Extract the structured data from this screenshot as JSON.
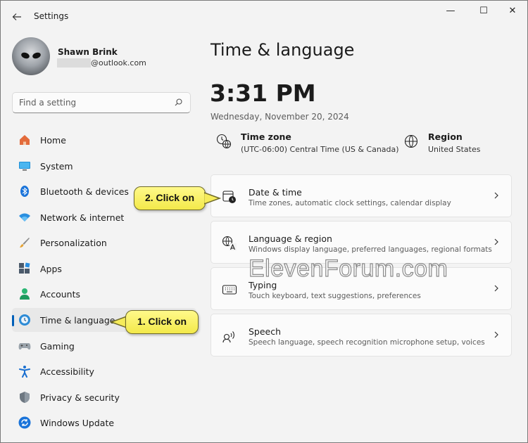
{
  "window": {
    "title": "Settings",
    "back_icon": "arrow-left-icon",
    "minimize_glyph": "—",
    "maximize_glyph": "☐",
    "close_glyph": "✕"
  },
  "user": {
    "name": "Shawn Brink",
    "email_suffix": "@outlook.com"
  },
  "search": {
    "placeholder": "Find a setting"
  },
  "sidebar": {
    "items": [
      {
        "label": "Home",
        "icon": "home-icon"
      },
      {
        "label": "System",
        "icon": "monitor-icon"
      },
      {
        "label": "Bluetooth & devices",
        "icon": "bluetooth-icon"
      },
      {
        "label": "Network & internet",
        "icon": "wifi-icon"
      },
      {
        "label": "Personalization",
        "icon": "brush-icon"
      },
      {
        "label": "Apps",
        "icon": "apps-icon"
      },
      {
        "label": "Accounts",
        "icon": "person-icon"
      },
      {
        "label": "Time & language",
        "icon": "globe-clock-icon",
        "selected": true
      },
      {
        "label": "Gaming",
        "icon": "gamepad-icon"
      },
      {
        "label": "Accessibility",
        "icon": "accessibility-icon"
      },
      {
        "label": "Privacy & security",
        "icon": "shield-icon"
      },
      {
        "label": "Windows Update",
        "icon": "update-icon"
      }
    ]
  },
  "main": {
    "title": "Time & language",
    "clock": "3:31 PM",
    "date": "Wednesday, November 20, 2024",
    "time_zone": {
      "label": "Time zone",
      "value": "(UTC-06:00) Central Time (US & Canada)"
    },
    "region": {
      "label": "Region",
      "value": "United States"
    },
    "cards": [
      {
        "title": "Date & time",
        "desc": "Time zones, automatic clock settings, calendar display",
        "icon": "calendar-clock-icon"
      },
      {
        "title": "Language & region",
        "desc": "Windows display language, preferred languages, regional formats",
        "icon": "language-icon"
      },
      {
        "title": "Typing",
        "desc": "Touch keyboard, text suggestions, preferences",
        "icon": "keyboard-icon"
      },
      {
        "title": "Speech",
        "desc": "Speech language, speech recognition microphone setup, voices",
        "icon": "speech-icon"
      }
    ]
  },
  "callouts": {
    "step1": "1. Click on",
    "step2": "2. Click on"
  },
  "watermark": "ElevenForum.com",
  "colors": {
    "accent": "#005fb8",
    "callout_fill": "#fff98a",
    "window_bg": "#f3f3f3"
  }
}
